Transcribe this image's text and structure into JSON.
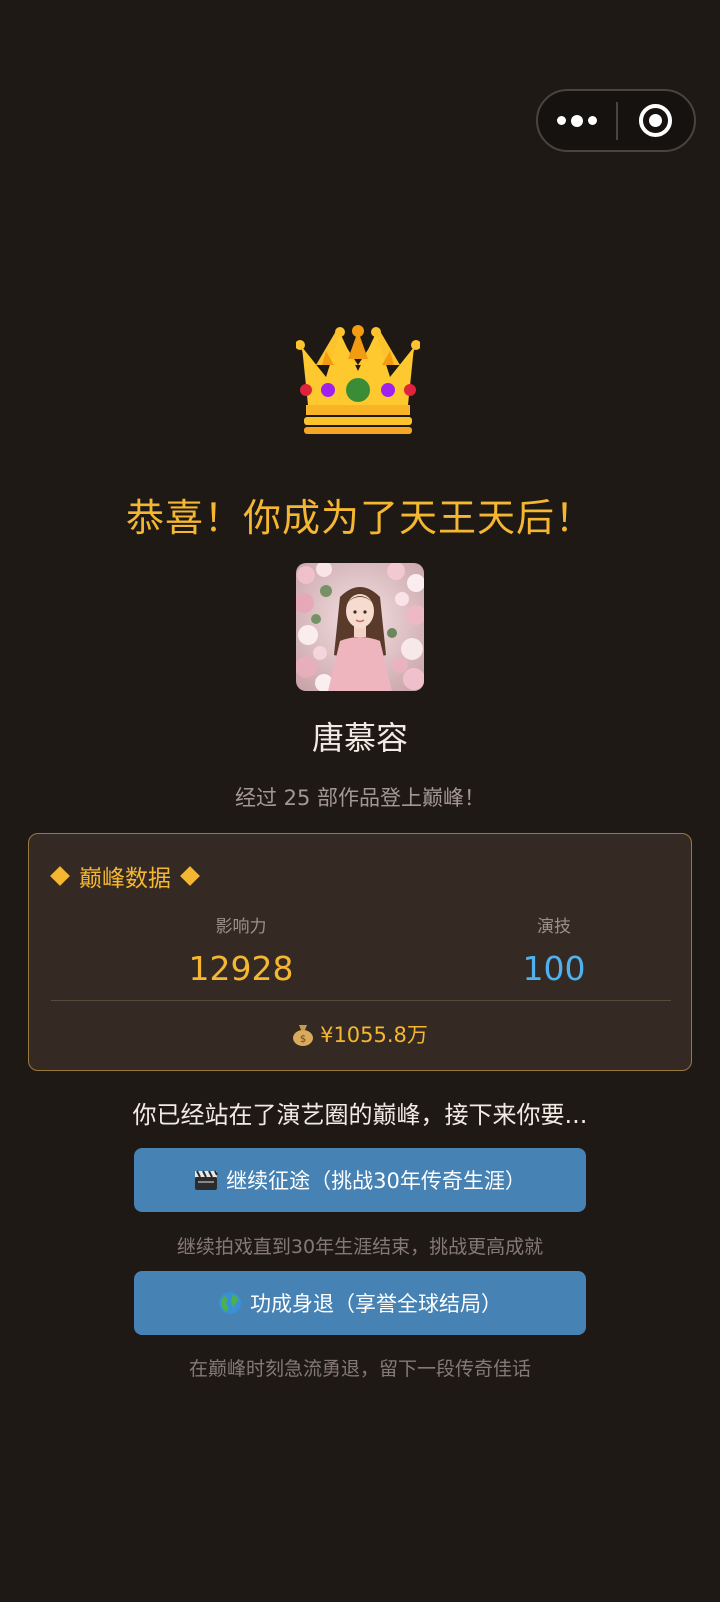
{
  "header": {
    "more_icon": "more-dots-icon",
    "close_icon": "target-icon"
  },
  "hero": {
    "crown_icon": "crown-icon",
    "title": "恭喜！你成为了天王天后！",
    "name": "唐慕容",
    "subtitle": "经过 25 部作品登上巅峰！"
  },
  "stats": {
    "title": "巅峰数据",
    "influence_label": "影响力",
    "influence_value": "12928",
    "acting_label": "演技",
    "acting_value": "100",
    "money": "¥1055.8万",
    "colors": {
      "gold": "#f5b731",
      "blue": "#4fb2ee"
    }
  },
  "choice": {
    "question": "你已经站在了演艺圈的巅峰，接下来你要...",
    "option1_label": "继续征途（挑战30年传奇生涯）",
    "option1_icon": "clapper-icon",
    "option1_hint": "继续拍戏直到30年生涯结束，挑战更高成就",
    "option2_label": "功成身退（享誉全球结局）",
    "option2_icon": "globe-icon",
    "option2_hint": "在巅峰时刻急流勇退，留下一段传奇佳话",
    "button_color": "#4682b4"
  }
}
